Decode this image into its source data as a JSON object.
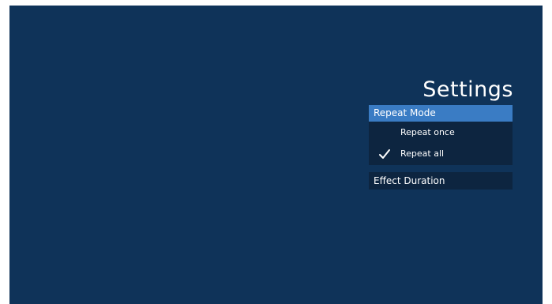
{
  "settings": {
    "title": "Settings",
    "repeat_mode": {
      "label": "Repeat Mode",
      "options": [
        {
          "label": "Repeat once",
          "selected": false
        },
        {
          "label": "Repeat all",
          "selected": true
        }
      ]
    },
    "effect_duration": {
      "label": "Effect Duration"
    }
  },
  "icons": {
    "check": "checkmark-icon"
  },
  "colors": {
    "background": "#0f3359",
    "highlight": "#3a7cc4",
    "panel": "#0d2540",
    "text": "#ffffff"
  }
}
